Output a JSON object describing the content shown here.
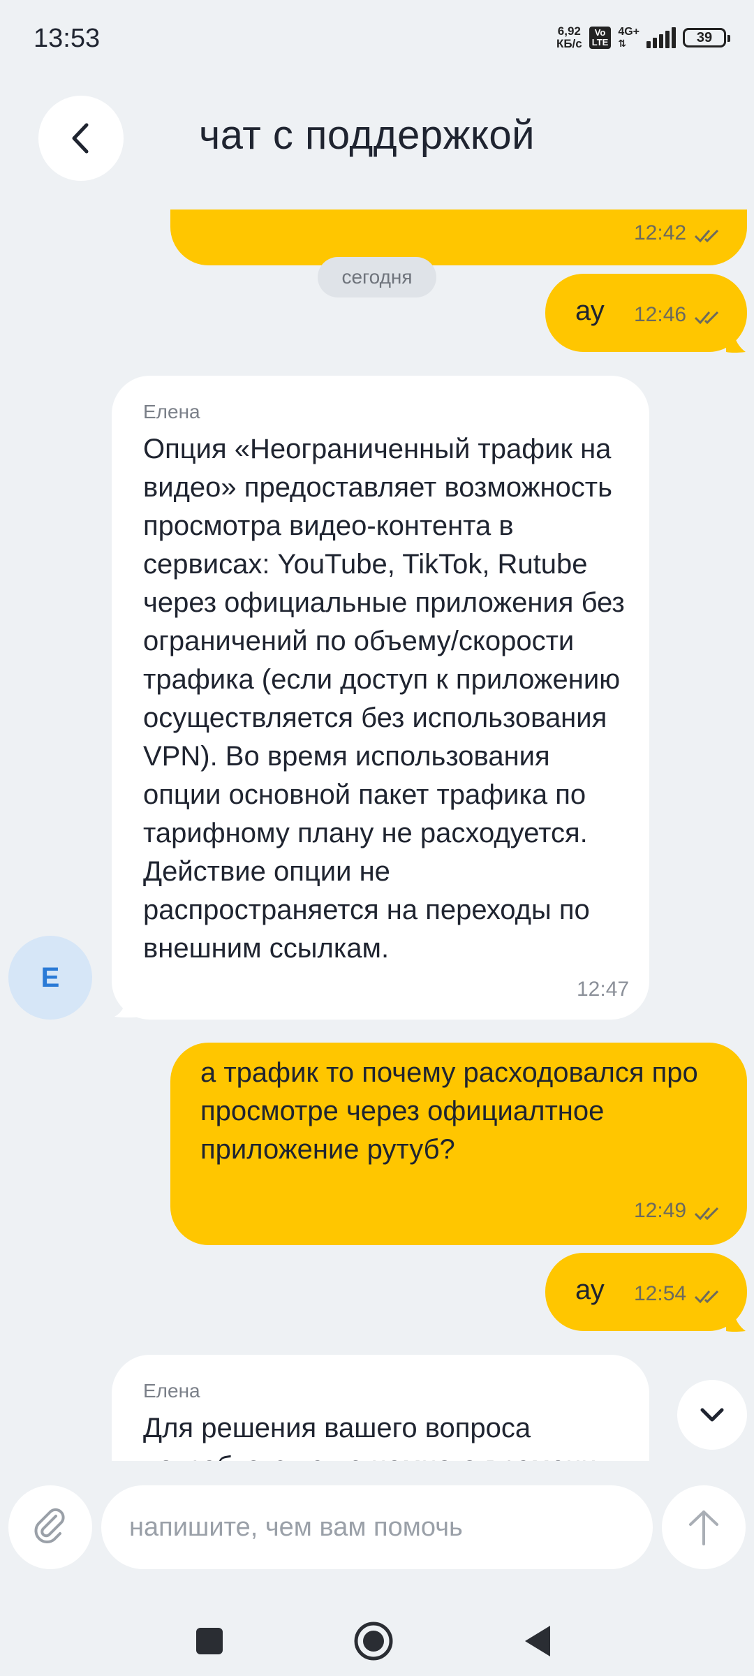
{
  "status_bar": {
    "time": "13:53",
    "speed_value": "6,92",
    "speed_unit": "КБ/с",
    "volte_top": "Vo",
    "volte_bottom": "LTE",
    "network": "4G+",
    "battery": "39"
  },
  "header": {
    "title": "чат с поддержкой"
  },
  "chat": {
    "day_divider": "сегодня",
    "messages": [
      {
        "direction": "out",
        "time": "12:42",
        "text": ""
      },
      {
        "direction": "out",
        "time": "12:46",
        "text": "ау"
      },
      {
        "direction": "in",
        "sender": "Елена",
        "time": "12:47",
        "text": "Опция «Неограниченный трафик на видео» предоставляет возможность просмотра видео-контента в сервисах: YouTube, TikTok, Rutube через официальные приложения без ограничений по объему/скорости трафика (если доступ к приложению осуществляется без использования VPN). Во время использования опции основной пакет трафика по тарифному плану не расходуется. Действие опции не распространяется на переходы по внешним ссылкам."
      },
      {
        "direction": "out",
        "time": "12:49",
        "text": "а трафик то почему расходовался про просмотре через официалтное приложение рутуб?"
      },
      {
        "direction": "out",
        "time": "12:54",
        "text": "ау"
      },
      {
        "direction": "in",
        "sender": "Елена",
        "text": "Для решения вашего вопроса потребуется еще немного времени"
      }
    ],
    "avatar_initial": "Е"
  },
  "composer": {
    "placeholder": "напишите, чем вам помочь"
  },
  "colors": {
    "outgoing_bubble": "#ffc600",
    "incoming_bubble": "#ffffff",
    "background": "#eef1f4",
    "avatar_bg": "#d6e6f7",
    "avatar_text": "#2a7ad6"
  },
  "icons": {
    "back": "chevron-left-icon",
    "scroll_down": "chevron-down-icon",
    "attach": "paperclip-icon",
    "send": "arrow-up-icon",
    "read": "double-check-icon"
  }
}
